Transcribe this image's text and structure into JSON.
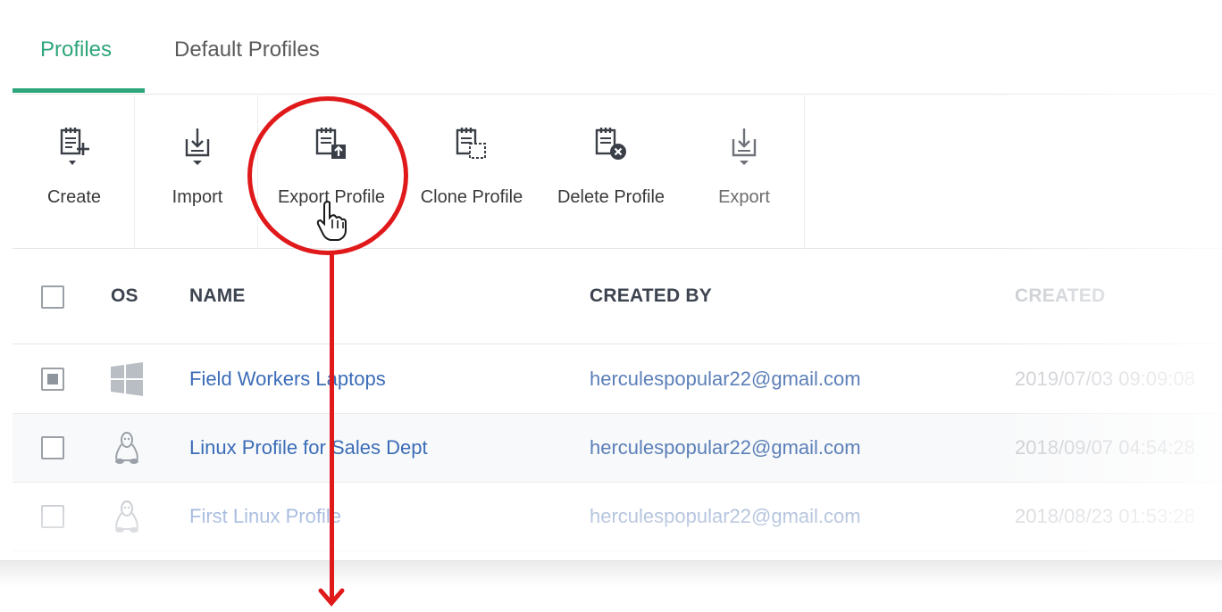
{
  "tabs": [
    {
      "label": "Profiles",
      "active": true
    },
    {
      "label": "Default Profiles",
      "active": false
    }
  ],
  "toolbar": {
    "create": "Create",
    "import": "Import",
    "export_profile": "Export Profile",
    "clone_profile": "Clone Profile",
    "delete_profile": "Delete Profile",
    "export": "Export"
  },
  "table": {
    "headers": {
      "os": "OS",
      "name": "NAME",
      "created_by": "CREATED BY",
      "created": "CREATED"
    },
    "rows": [
      {
        "checked": true,
        "os": "windows-icon",
        "name": "Field Workers Laptops",
        "created_by": "herculespopular22@gmail.com",
        "created": "2019/07/03 09:09:08"
      },
      {
        "checked": false,
        "os": "linux-icon",
        "name": "Linux Profile for Sales Dept",
        "created_by": "herculespopular22@gmail.com",
        "created": "2018/09/07 04:54:28"
      },
      {
        "checked": false,
        "os": "linux-icon",
        "name": "First Linux Profile",
        "created_by": "herculespopular22@gmail.com",
        "created": "2018/08/23 01:53:28"
      }
    ]
  },
  "colors": {
    "accent": "#2ea57a",
    "annotation": "#e0191b",
    "link": "#3b6cb7"
  }
}
